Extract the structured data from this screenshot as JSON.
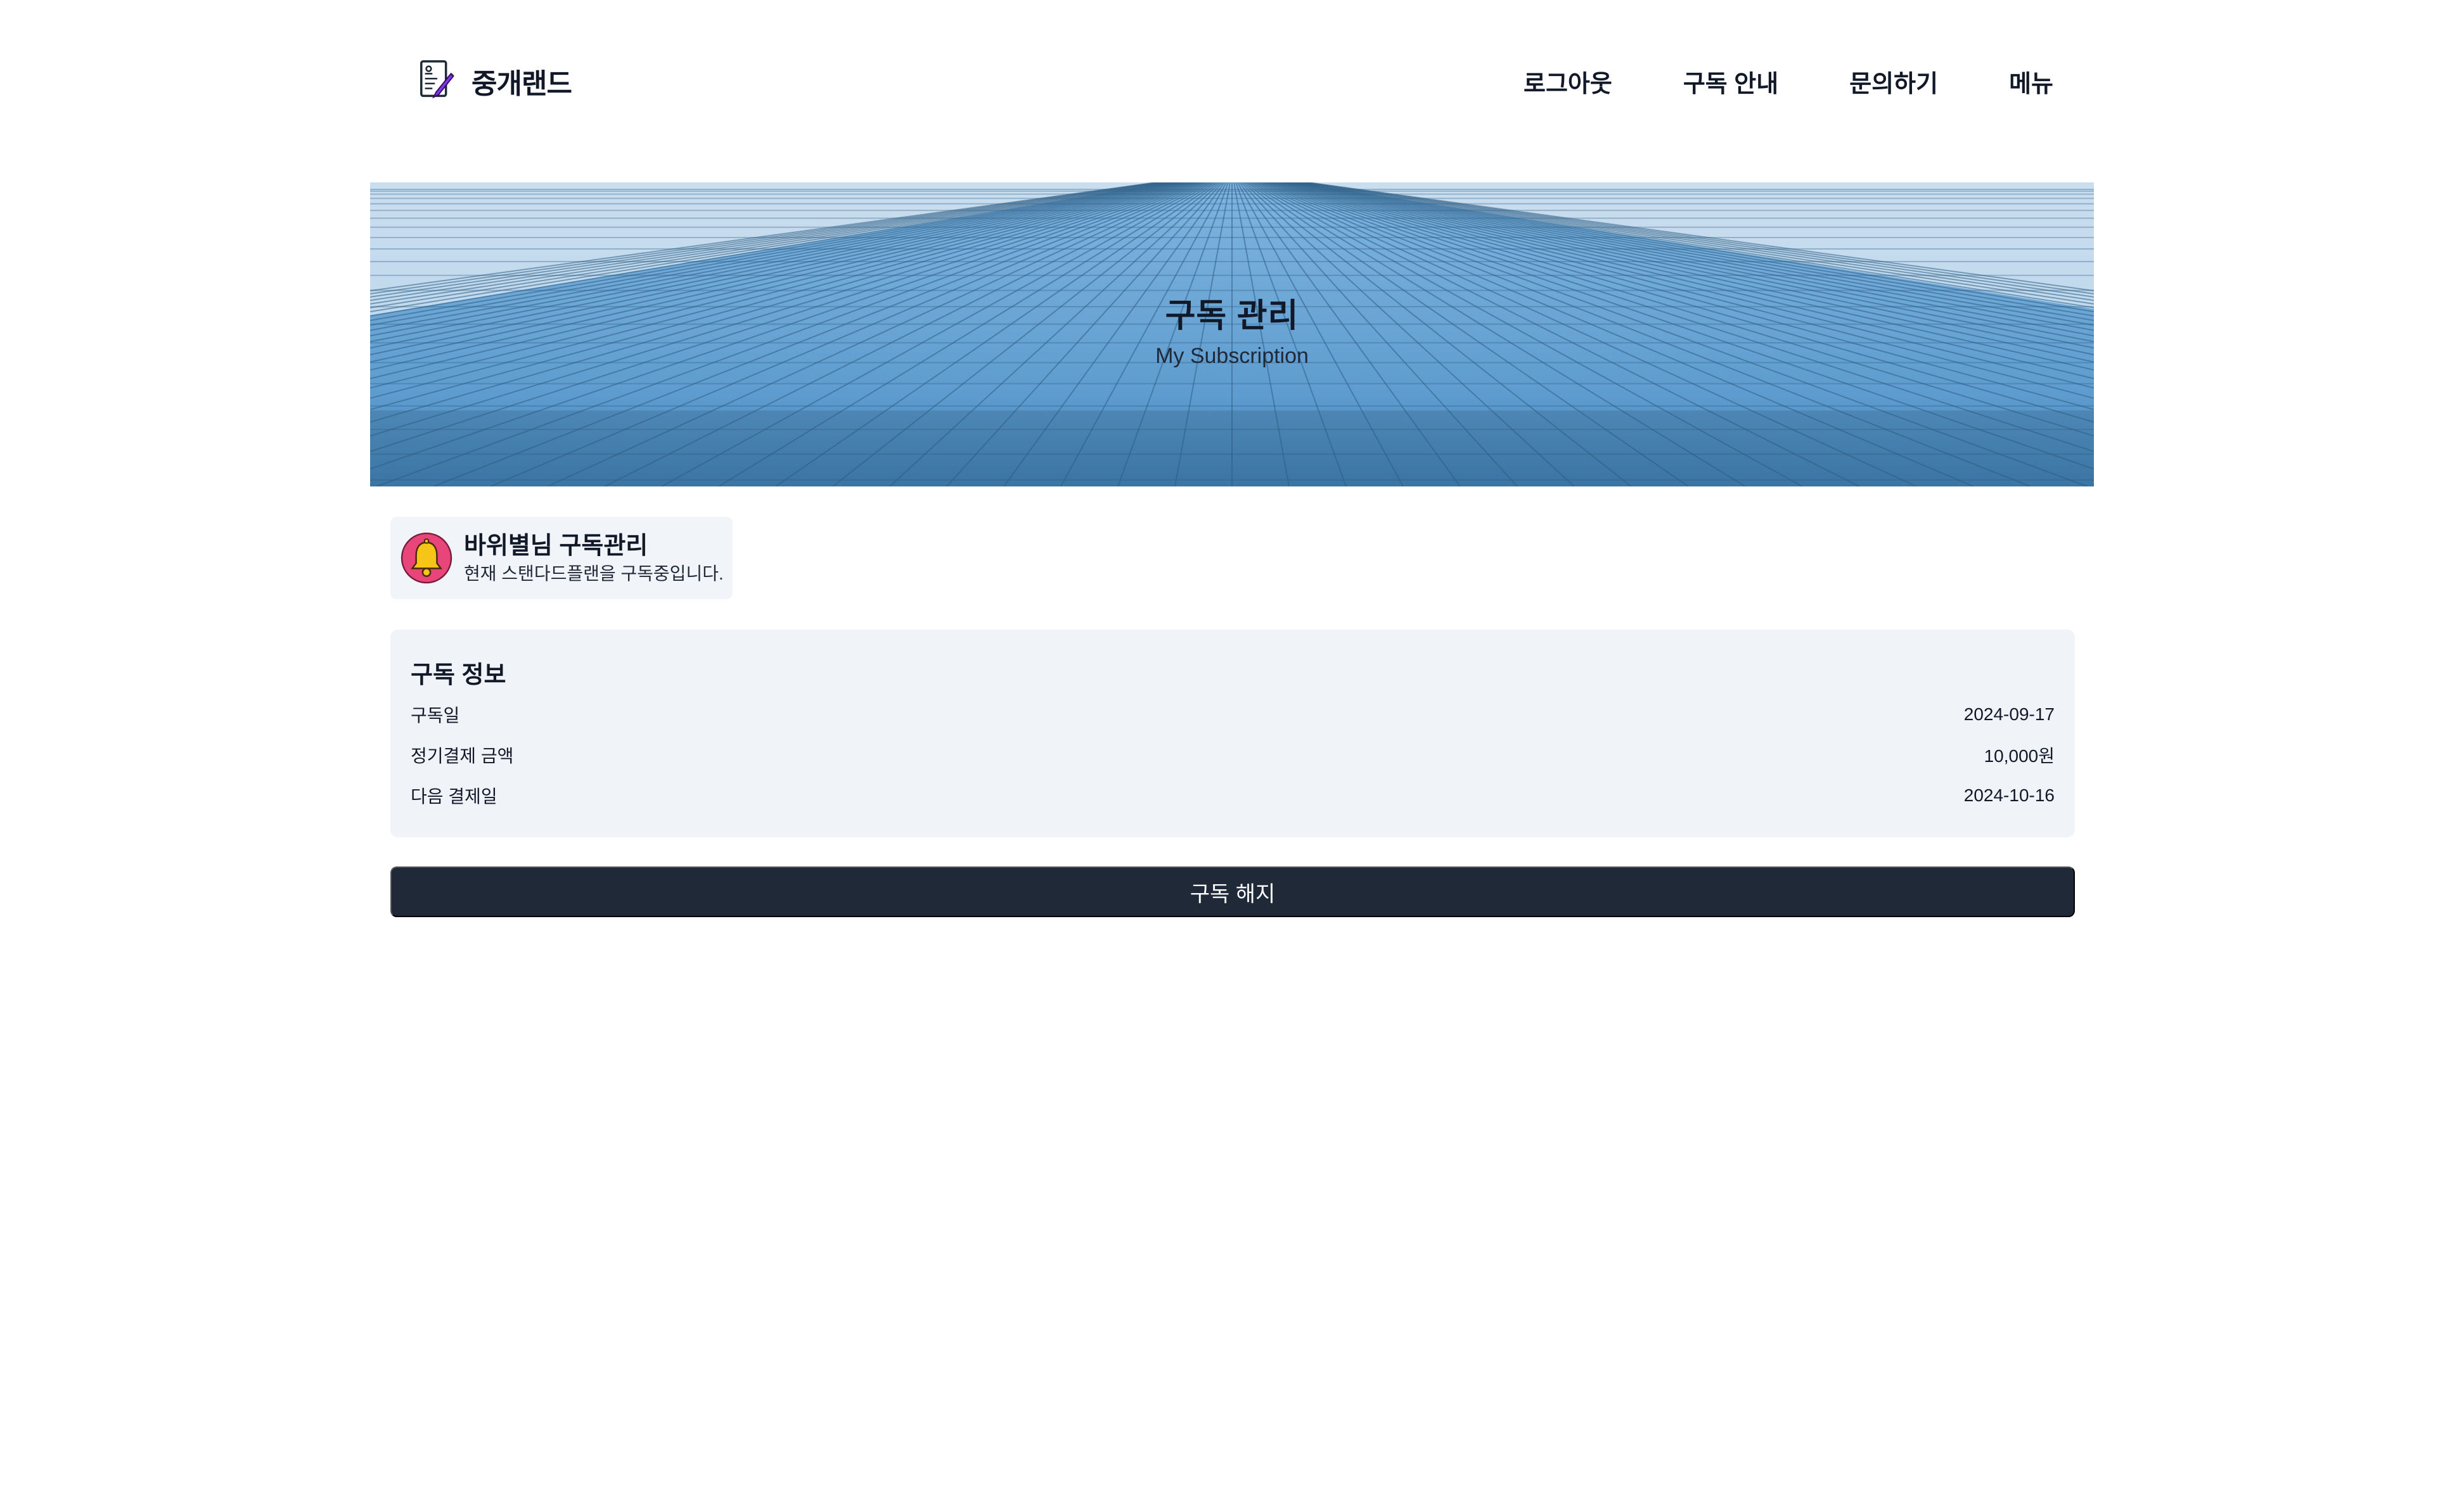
{
  "header": {
    "logo_text": "중개랜드",
    "nav": [
      "로그아웃",
      "구독 안내",
      "문의하기",
      "메뉴"
    ]
  },
  "hero": {
    "title": "구독 관리",
    "subtitle": "My Subscription"
  },
  "profile": {
    "name": "바위별님 구독관리",
    "description": "현재 스탠다드플랜을 구독중입니다."
  },
  "subscription_info": {
    "title": "구독 정보",
    "rows": [
      {
        "label": "구독일",
        "value": "2024-09-17"
      },
      {
        "label": "정기결제 금액",
        "value": "10,000원"
      },
      {
        "label": "다음 결제일",
        "value": "2024-10-16"
      }
    ]
  },
  "actions": {
    "cancel_label": "구독 해지"
  },
  "colors": {
    "button_bg": "#1f2937",
    "card_bg": "#f0f4f8",
    "bell_circle": "#e8457a",
    "bell_body": "#f5c518",
    "logo_pen": "#7c3aed"
  },
  "icons": {
    "logo": "document-pen-icon",
    "profile": "bell-icon"
  }
}
